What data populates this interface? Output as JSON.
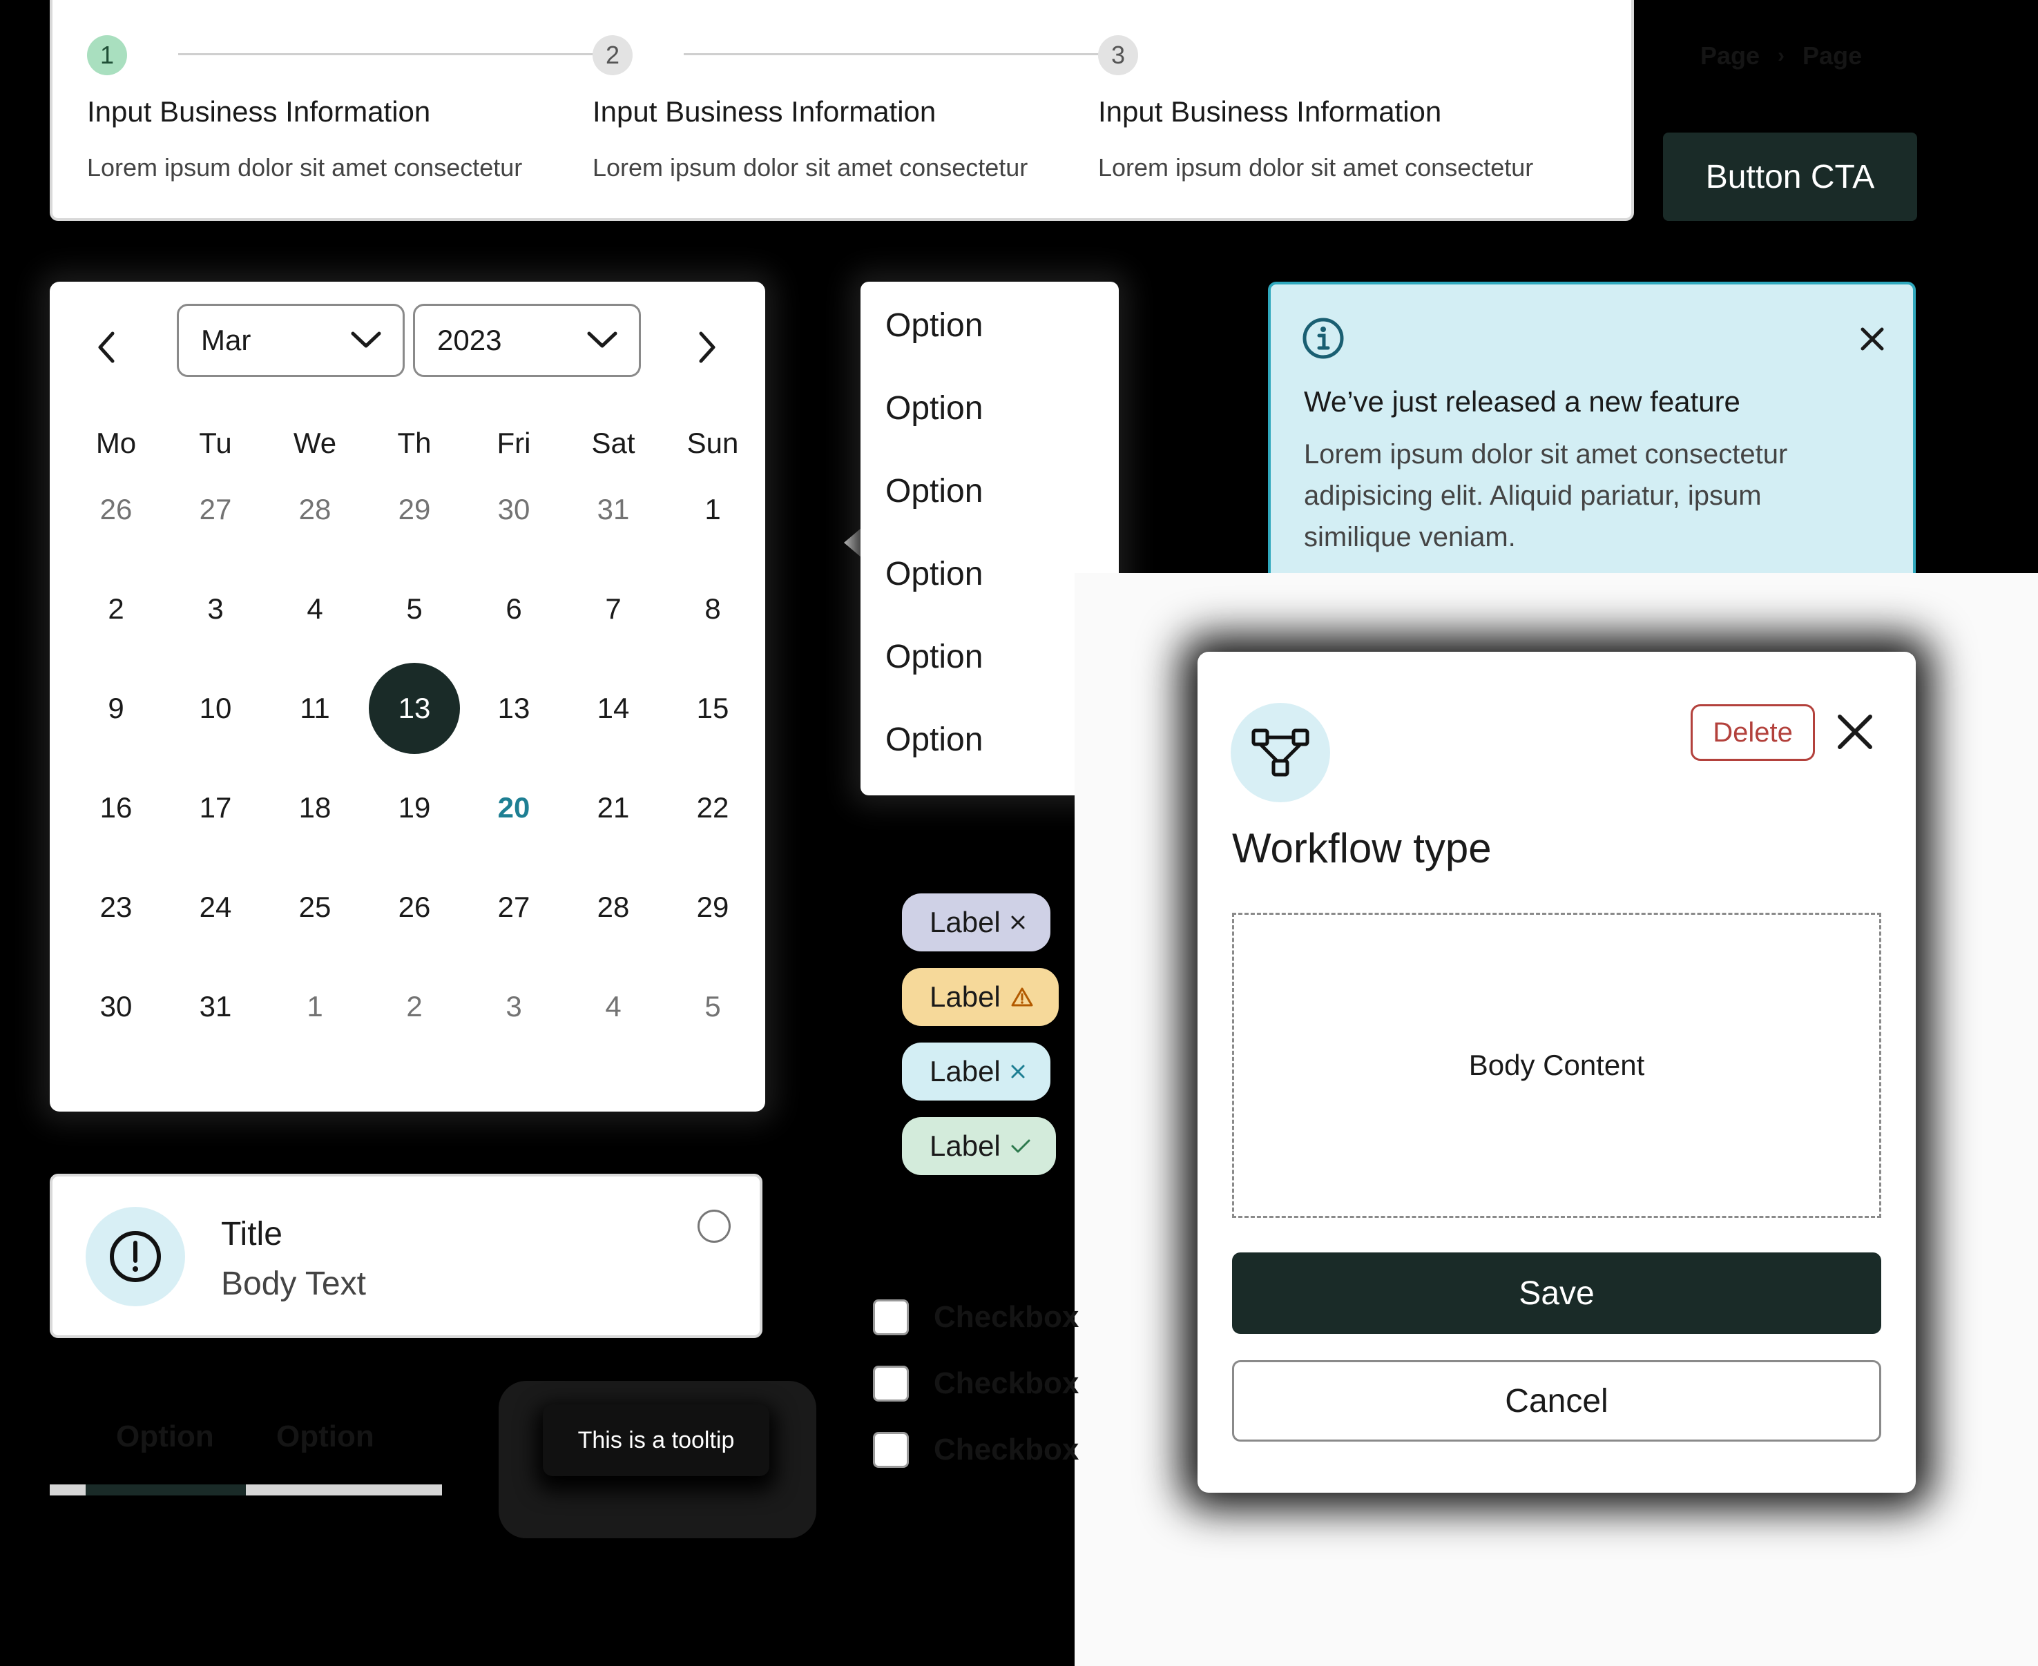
{
  "stepper": {
    "steps": [
      {
        "number": "1",
        "title": "Input Business Information",
        "description": "Lorem ipsum dolor sit amet consectetur"
      },
      {
        "number": "2",
        "title": "Input Business Information",
        "description": "Lorem ipsum dolor sit amet consectetur"
      },
      {
        "number": "3",
        "title": "Input Business Information",
        "description": "Lorem ipsum dolor sit amet consectetur"
      }
    ]
  },
  "breadcrumb": {
    "items": [
      "Page",
      "Page"
    ],
    "separator": "›"
  },
  "cta": {
    "label": "Button CTA"
  },
  "calendar": {
    "month": "Mar",
    "year": "2023",
    "weekdays": [
      "Mo",
      "Tu",
      "We",
      "Th",
      "Fri",
      "Sat",
      "Sun"
    ],
    "weeks": [
      [
        "26",
        "27",
        "28",
        "29",
        "30",
        "31",
        "1"
      ],
      [
        "2",
        "3",
        "4",
        "5",
        "6",
        "7",
        "8"
      ],
      [
        "9",
        "10",
        "11",
        "13",
        "13",
        "14",
        "15"
      ],
      [
        "16",
        "17",
        "18",
        "19",
        "20",
        "21",
        "22"
      ],
      [
        "23",
        "24",
        "25",
        "26",
        "27",
        "28",
        "29"
      ],
      [
        "30",
        "31",
        "1",
        "2",
        "3",
        "4",
        "5"
      ]
    ],
    "selected_day": "13",
    "today": "20"
  },
  "menu": {
    "options": [
      "Option",
      "Option",
      "Option",
      "Option",
      "Option",
      "Option"
    ]
  },
  "alert": {
    "title": "We’ve just released a new feature",
    "body": "Lorem ipsum dolor sit amet consectetur adipisicing elit. Aliquid pariatur, ipsum similique veniam."
  },
  "modal": {
    "title": "Workflow type",
    "delete_label": "Delete",
    "body_placeholder": "Body Content",
    "save_label": "Save",
    "cancel_label": "Cancel"
  },
  "tags": [
    {
      "label": "Label",
      "icon": "close-icon",
      "color": "#cfd1e6"
    },
    {
      "label": "Label",
      "icon": "warning-icon",
      "color": "#f6d99a"
    },
    {
      "label": "Label",
      "icon": "close-icon",
      "color": "#d3eef4"
    },
    {
      "label": "Label",
      "icon": "check-icon",
      "color": "#d3ebdb"
    }
  ],
  "card": {
    "title": "Title",
    "body": "Body Text"
  },
  "checkboxes": [
    {
      "label": "Checkbox"
    },
    {
      "label": "Checkbox"
    },
    {
      "label": "Checkbox"
    }
  ],
  "tabs": [
    {
      "label": "Option"
    },
    {
      "label": "Option"
    }
  ],
  "tooltip": {
    "text": "This is a tooltip"
  },
  "colors": {
    "primary": "#1a2b28",
    "accent_teal": "#1e7f93",
    "danger": "#b3413c",
    "step_active": "#a9dfbf"
  }
}
